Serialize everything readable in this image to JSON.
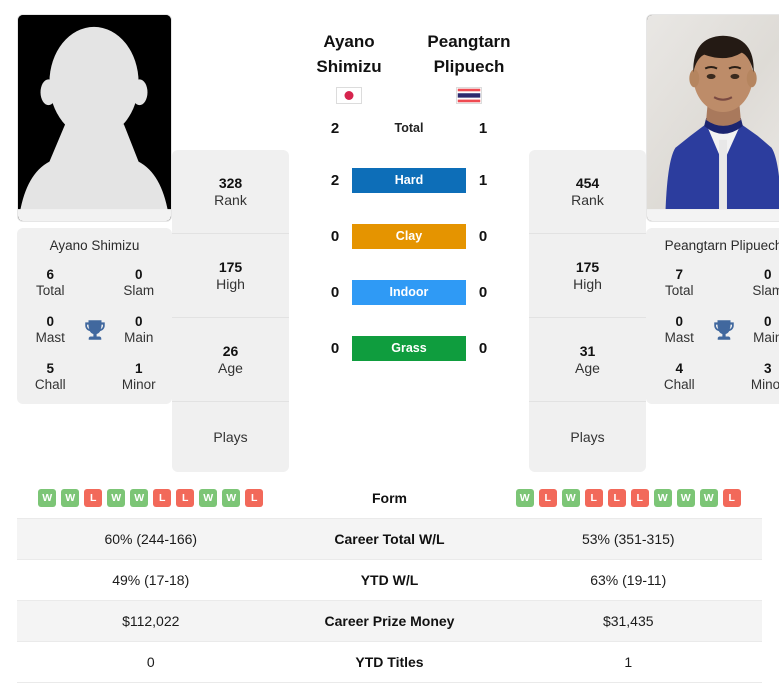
{
  "players": {
    "left": {
      "first_name": "Ayano",
      "last_name": "Shimizu",
      "full_name": "Ayano Shimizu",
      "country": "Japan",
      "flag": "jp-flag",
      "photo": "avatar-placeholder-icon",
      "titles": {
        "total_value": "6",
        "total_label": "Total",
        "slam_value": "0",
        "slam_label": "Slam",
        "mast_value": "0",
        "mast_label": "Mast",
        "main_value": "0",
        "main_label": "Main",
        "chall_value": "5",
        "chall_label": "Chall",
        "minor_value": "1",
        "minor_label": "Minor"
      },
      "stats": {
        "rank_value": "328",
        "rank_label": "Rank",
        "high_value": "175",
        "high_label": "High",
        "age_value": "26",
        "age_label": "Age",
        "plays_label": "Plays",
        "plays_value": ""
      },
      "form": [
        "W",
        "W",
        "L",
        "W",
        "W",
        "L",
        "L",
        "W",
        "W",
        "L"
      ],
      "career_total_wl": "60% (244-166)",
      "ytd_wl": "49% (17-18)",
      "career_prize_money": "$112,022",
      "ytd_titles": "0"
    },
    "right": {
      "first_name": "Peangtarn",
      "last_name": "Plipuech",
      "full_name": "Peangtarn Plipuech",
      "country": "Thailand",
      "flag": "th-flag",
      "photo": "player-portrait-photo",
      "titles": {
        "total_value": "7",
        "total_label": "Total",
        "slam_value": "0",
        "slam_label": "Slam",
        "mast_value": "0",
        "mast_label": "Mast",
        "main_value": "0",
        "main_label": "Main",
        "chall_value": "4",
        "chall_label": "Chall",
        "minor_value": "3",
        "minor_label": "Minor"
      },
      "stats": {
        "rank_value": "454",
        "rank_label": "Rank",
        "high_value": "175",
        "high_label": "High",
        "age_value": "31",
        "age_label": "Age",
        "plays_label": "Plays",
        "plays_value": ""
      },
      "form": [
        "W",
        "L",
        "W",
        "L",
        "L",
        "L",
        "W",
        "W",
        "W",
        "L"
      ],
      "career_total_wl": "53% (351-315)",
      "ytd_wl": "63% (19-11)",
      "career_prize_money": "$31,435",
      "ytd_titles": "1"
    }
  },
  "head_to_head": {
    "rows": [
      {
        "label": "Total",
        "left": "2",
        "right": "1",
        "type": "plain",
        "color": ""
      },
      {
        "label": "Hard",
        "left": "2",
        "right": "1",
        "type": "badge",
        "color": "#0d6eb8"
      },
      {
        "label": "Clay",
        "left": "0",
        "right": "0",
        "type": "badge",
        "color": "#e59400"
      },
      {
        "label": "Indoor",
        "left": "0",
        "right": "0",
        "type": "badge",
        "color": "#2f9af5"
      },
      {
        "label": "Grass",
        "left": "0",
        "right": "0",
        "type": "badge",
        "color": "#0f9d3e"
      }
    ]
  },
  "comparison_table": {
    "rows": [
      {
        "label": "Form"
      },
      {
        "label": "Career Total W/L",
        "left": "60% (244-166)",
        "right": "53% (351-315)"
      },
      {
        "label": "YTD W/L",
        "left": "49% (17-18)",
        "right": "63% (19-11)"
      },
      {
        "label": "Career Prize Money",
        "left": "$112,022",
        "right": "$31,435"
      },
      {
        "label": "YTD Titles",
        "left": "0",
        "right": "1"
      }
    ]
  },
  "colors": {
    "win": "#7cc576",
    "loss": "#f2695a",
    "trophy": "#41689e",
    "card_bg": "#f0f0f0",
    "row_alt": "#f4f4f4"
  }
}
